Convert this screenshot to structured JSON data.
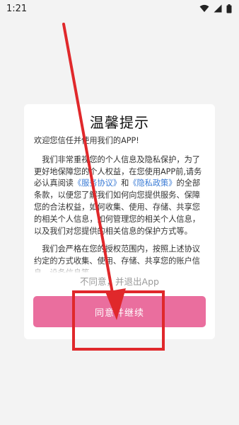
{
  "status_bar": {
    "time": "1:21",
    "icons": [
      "wifi-icon",
      "signal-icon",
      "battery-icon"
    ]
  },
  "dialog": {
    "title": "温馨提示",
    "welcome": "欢迎您信任并使用我们的APP!",
    "paragraph1": {
      "before_links": "我们非常重视您的个人信息及隐私保护，为了更好地保障您的个人权益，在您使用APP前,请务必认真阅读",
      "link_service": "《服务协议》",
      "and": "和",
      "link_privacy": "《隐私政策》",
      "after_links": "的全部条款，以便您了解我们如何向您提供服务、保障您的合法权益，如何收集、使用、存储、共享您的相关个人信息，如何管理您的相关个人信息，以及我们对您提供的相关信息的保护方式等。"
    },
    "paragraph2": "我们会严格在您的授权范围内，按照上述协议约定的方式收集、使用、存储、共享您的账户信息、设备信息等。",
    "decline_label": "不同意，并退出App",
    "agree_label": "同意并继续"
  },
  "annotation": {
    "color": "#e0282b"
  },
  "colors": {
    "agree_button": "#ea6e9e",
    "link": "#3a7bd5",
    "background": "#f3f3f3"
  }
}
